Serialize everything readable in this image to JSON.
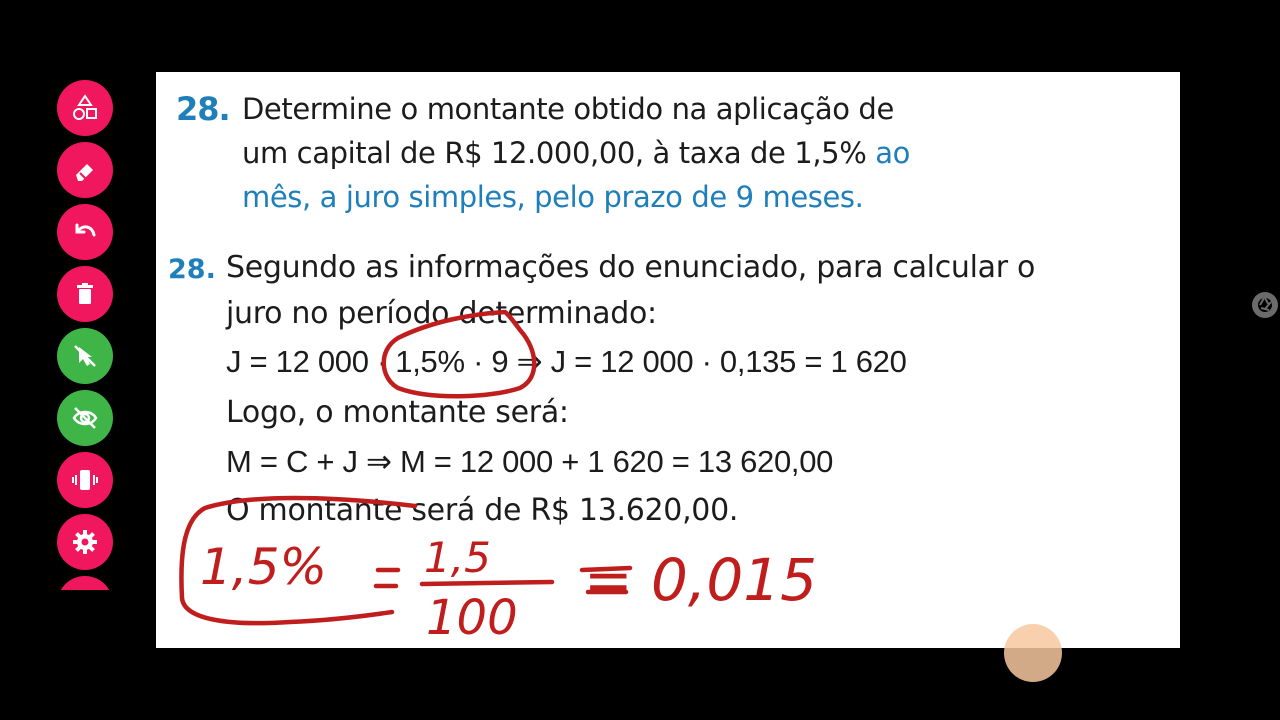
{
  "question": {
    "number": "28.",
    "line1": "Determine o montante obtido na aplicação de",
    "line2_black": "um capital de R$ 12.000,00, à taxa de 1,5%",
    "line2_blue": " ao",
    "line3": "mês, a juro simples, pelo prazo de 9 meses."
  },
  "answer": {
    "number": "28.",
    "line1": "Segundo as informações do enunciado, para calcular o",
    "line2": "juro no período determinado:",
    "eq1": "J = 12 000 · 1,5% · 9 ⇒ J = 12 000 · 0,135 = 1 620",
    "line4": "Logo, o montante será:",
    "eq2": "M = C + J ⇒ M = 12 000 + 1 620 = 13 620,00",
    "line6": "O montante será de R$ 13.620,00."
  },
  "handwriting": {
    "left": "1,5%",
    "numerator": "1,5",
    "denominator": "100",
    "result": "= 0,015"
  },
  "colors": {
    "accent_blue": "#1f7fba",
    "ink_red": "#c01d1d",
    "toolbar_pink": "#f0175f",
    "toolbar_green": "#3fb548"
  },
  "toolbar": {
    "items": [
      {
        "name": "shapes-tool",
        "icon": "shapes-icon",
        "color": "pink"
      },
      {
        "name": "eraser-tool",
        "icon": "eraser-icon",
        "color": "pink"
      },
      {
        "name": "undo-button",
        "icon": "undo-icon",
        "color": "pink"
      },
      {
        "name": "clear-button",
        "icon": "trash-icon",
        "color": "pink"
      },
      {
        "name": "pass-through-toggle",
        "icon": "cursor-off-icon",
        "color": "green"
      },
      {
        "name": "hide-toggle",
        "icon": "eye-off-icon",
        "color": "green"
      },
      {
        "name": "vibrate-toggle",
        "icon": "vibrate-icon",
        "color": "pink"
      },
      {
        "name": "settings-button",
        "icon": "gear-icon",
        "color": "pink"
      }
    ]
  }
}
